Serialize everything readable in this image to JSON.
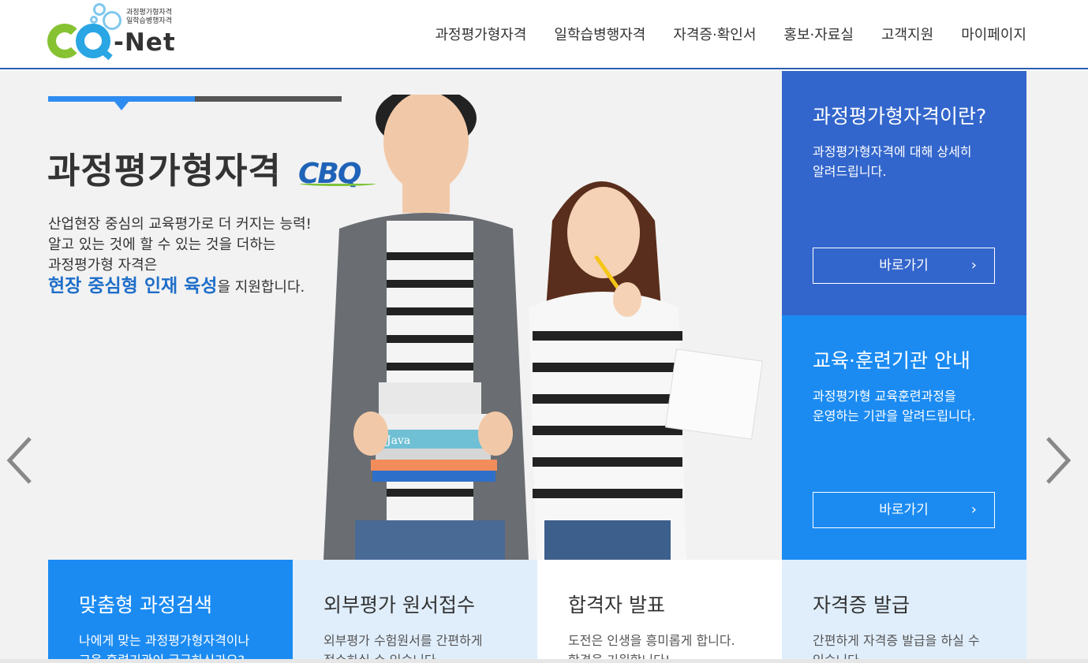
{
  "header": {
    "logo": {
      "sub_line1": "과정평가형자격",
      "sub_line2": "일학습병행자격",
      "name": "-Net"
    },
    "nav": [
      "과정평가형자격",
      "일학습병행자격",
      "자격증·확인서",
      "홍보·자료실",
      "고객지원",
      "마이페이지"
    ]
  },
  "hero": {
    "progress": 0.5,
    "title": "과정평가형자격",
    "title_badge": "CBQ",
    "desc": [
      "산업현장 중심의 교육평가로 더 커지는 능력!",
      "알고 있는 것에 할 수 있는 것을 더하는",
      "과정평가형 자격은"
    ],
    "desc_highlight": "현장 중심형 인재 육성",
    "desc_tail": "을 지원합니다.",
    "book_label": "Java"
  },
  "panels": [
    {
      "title": "과정평가형자격이란?",
      "desc": [
        "과정평가형자격에 대해 상세히",
        "알려드립니다."
      ],
      "button": "바로가기"
    },
    {
      "title": "교육·훈련기관 안내",
      "desc": [
        "과정평가형 교육훈련과정을",
        "운영하는 기관을 알려드립니다."
      ],
      "button": "바로가기"
    }
  ],
  "tiles": [
    {
      "title": "맞춤형 과정검색",
      "desc": [
        "나에게 맞는 과정평가형자격이나",
        "교육·훈련기관이 궁금하신가요?"
      ]
    },
    {
      "title": "외부평가 원서접수",
      "desc": [
        "외부평가 수험원서를 간편하게",
        "접수하실 수 있습니다."
      ]
    },
    {
      "title": "합격자 발표",
      "desc": [
        "도전은 인생을 흥미롭게 합니다.",
        "합격을 기원합니다!"
      ]
    },
    {
      "title": "자격증 발급",
      "desc": [
        "간편하게 자격증 발급을 하실 수",
        "있습니다."
      ]
    }
  ],
  "colors": {
    "brand_blue": "#3366cc",
    "accent_blue": "#1b8bf2",
    "light_blue": "#e0eefc",
    "logo_green": "#86c232"
  }
}
